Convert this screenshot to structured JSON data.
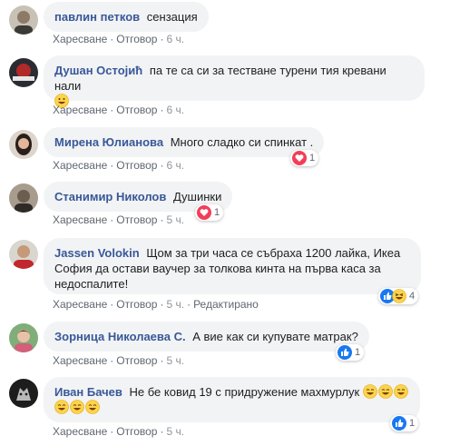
{
  "comments": [
    {
      "author": "павлин петков",
      "text": "сензация",
      "actions": {
        "like": "Харесване",
        "reply": "Отговор",
        "time": "6 ч."
      }
    },
    {
      "author": "Душан Остојић",
      "text": "па те са си за тестване турени тия кревани нали",
      "actions": {
        "like": "Харесване",
        "reply": "Отговор",
        "time": "6 ч."
      }
    },
    {
      "author": "Мирена Юлианова",
      "text": "Много сладко си спинкат .",
      "actions": {
        "like": "Харесване",
        "reply": "Отговор",
        "time": "6 ч."
      },
      "reaction_count": "1"
    },
    {
      "author": "Станимир Николов",
      "text": "Душинки",
      "actions": {
        "like": "Харесване",
        "reply": "Отговор",
        "time": "5 ч."
      },
      "reaction_count": "1"
    },
    {
      "author": "Jassen Volokin",
      "text_lines": [
        "Щом за три часа се събраха 1200 лайка, Икеа",
        "София да остави ваучер за толкова кинта на първа каса за",
        "недоспалите!"
      ],
      "actions": {
        "like": "Харесване",
        "reply": "Отговор",
        "time": "5 ч.",
        "edited": "Редактирано"
      },
      "reaction_count": "4"
    },
    {
      "author": "Зорница Николаева С.",
      "text": "А вие как си купувате матрак?",
      "actions": {
        "like": "Харесване",
        "reply": "Отговор",
        "time": "5 ч."
      },
      "reaction_count": "1"
    },
    {
      "author": "Иван Бачев",
      "text": "Не бе ковид 19 с придружение махмурлук",
      "actions": {
        "like": "Харесване",
        "reply": "Отговор",
        "time": "5 ч."
      },
      "reaction_count": "1"
    }
  ],
  "colors": {
    "author": "#385898",
    "bubble": "#f2f3f5",
    "meta": "#606770",
    "like_blue": "#1877f2",
    "love_red": "#f33e58",
    "haha_yellow": "#fcd34d"
  },
  "icons": [
    "avatar",
    "grinning-face-emoji",
    "laughing-face-emoji",
    "love-reaction-icon",
    "like-reaction-icon",
    "haha-reaction-icon"
  ]
}
